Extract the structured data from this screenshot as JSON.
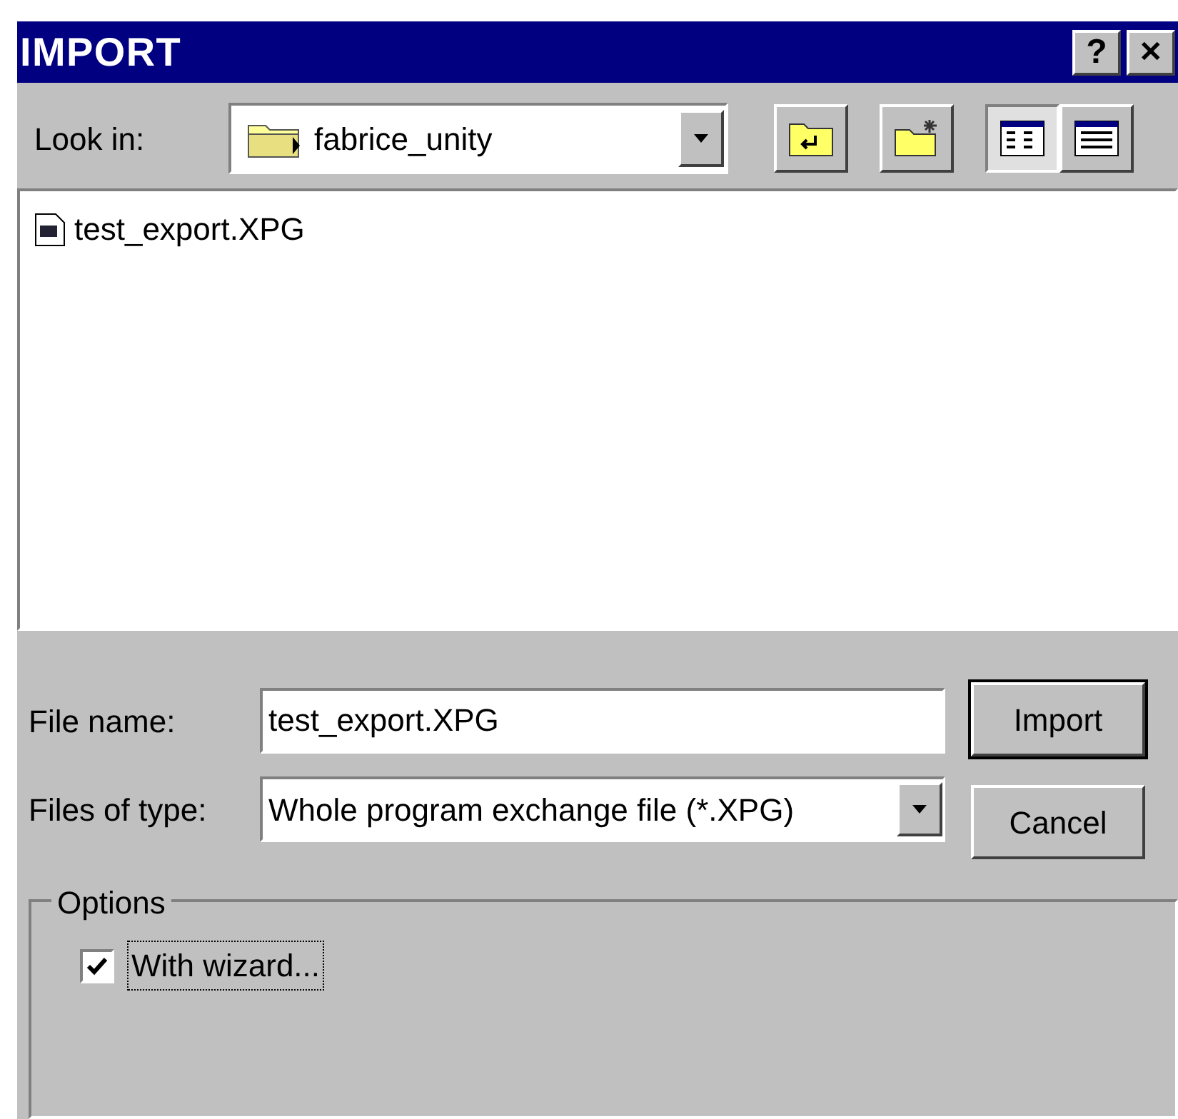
{
  "window": {
    "title": "IMPORT"
  },
  "title_buttons": [
    {
      "kind": "help",
      "label": "?"
    },
    {
      "kind": "close",
      "label": "✕"
    }
  ],
  "look_in": {
    "label": "Look in:",
    "value": "fabrice_unity"
  },
  "toolbar": [
    {
      "kind": "up",
      "selected": false
    },
    {
      "kind": "new-folder",
      "selected": false
    },
    {
      "kind": "list",
      "selected": true
    },
    {
      "kind": "details",
      "selected": false
    }
  ],
  "files": [
    {
      "name": "test_export.XPG",
      "selected": false
    }
  ],
  "file_name": {
    "label": "File name:",
    "value": "test_export.XPG"
  },
  "file_type": {
    "label": "Files of type:",
    "value": "Whole program exchange file (*.XPG)"
  },
  "buttons": [
    {
      "label": "Import",
      "default": true
    },
    {
      "label": "Cancel",
      "default": false
    }
  ],
  "options": {
    "title": "Options",
    "items": [
      {
        "label": "With wizard...",
        "checked": true,
        "focused": true
      }
    ]
  }
}
